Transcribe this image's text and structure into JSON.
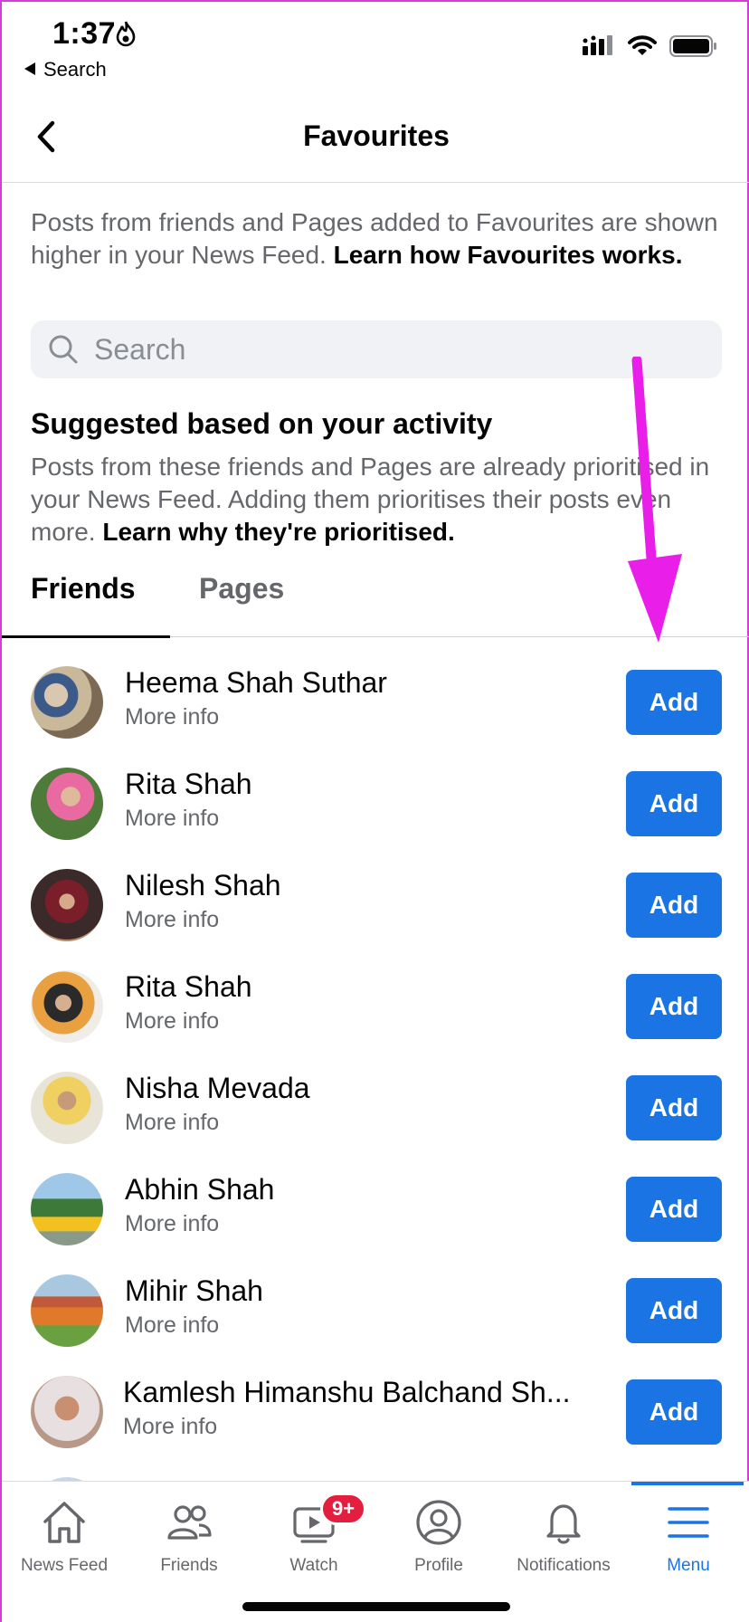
{
  "status_bar": {
    "time": "1:37",
    "back_label": "Search"
  },
  "header": {
    "title": "Favourites"
  },
  "intro": {
    "text": "Posts from friends and Pages added to Favourites are shown higher in your News Feed.",
    "link": "Learn how Favourites works."
  },
  "search": {
    "placeholder": "Search"
  },
  "suggested": {
    "title": "Suggested based on your activity",
    "text": "Posts from these friends and Pages are already prioritised in your News Feed. Adding them prioritises their posts even more.",
    "link": "Learn why they're prioritised."
  },
  "tabs": {
    "friends": "Friends",
    "pages": "Pages"
  },
  "friends": [
    {
      "name": "Heema Shah Suthar",
      "sub": "More info",
      "button": "Add"
    },
    {
      "name": "Rita Shah",
      "sub": "More info",
      "button": "Add"
    },
    {
      "name": "Nilesh Shah",
      "sub": "More info",
      "button": "Add"
    },
    {
      "name": "Rita Shah",
      "sub": "More info",
      "button": "Add"
    },
    {
      "name": "Nisha Mevada",
      "sub": "More info",
      "button": "Add"
    },
    {
      "name": "Abhin Shah",
      "sub": "More info",
      "button": "Add"
    },
    {
      "name": "Mihir Shah",
      "sub": "More info",
      "button": "Add"
    },
    {
      "name": "Kamlesh Himanshu Balchand Sh...",
      "sub": "More info",
      "button": "Add"
    }
  ],
  "tabbar": {
    "news_feed": "News Feed",
    "friends": "Friends",
    "watch": "Watch",
    "watch_badge": "9+",
    "profile": "Profile",
    "notifications": "Notifications",
    "menu": "Menu"
  },
  "colors": {
    "accent": "#1b74e4",
    "annotation_arrow": "#e91ee9",
    "badge": "#e41e3f"
  }
}
